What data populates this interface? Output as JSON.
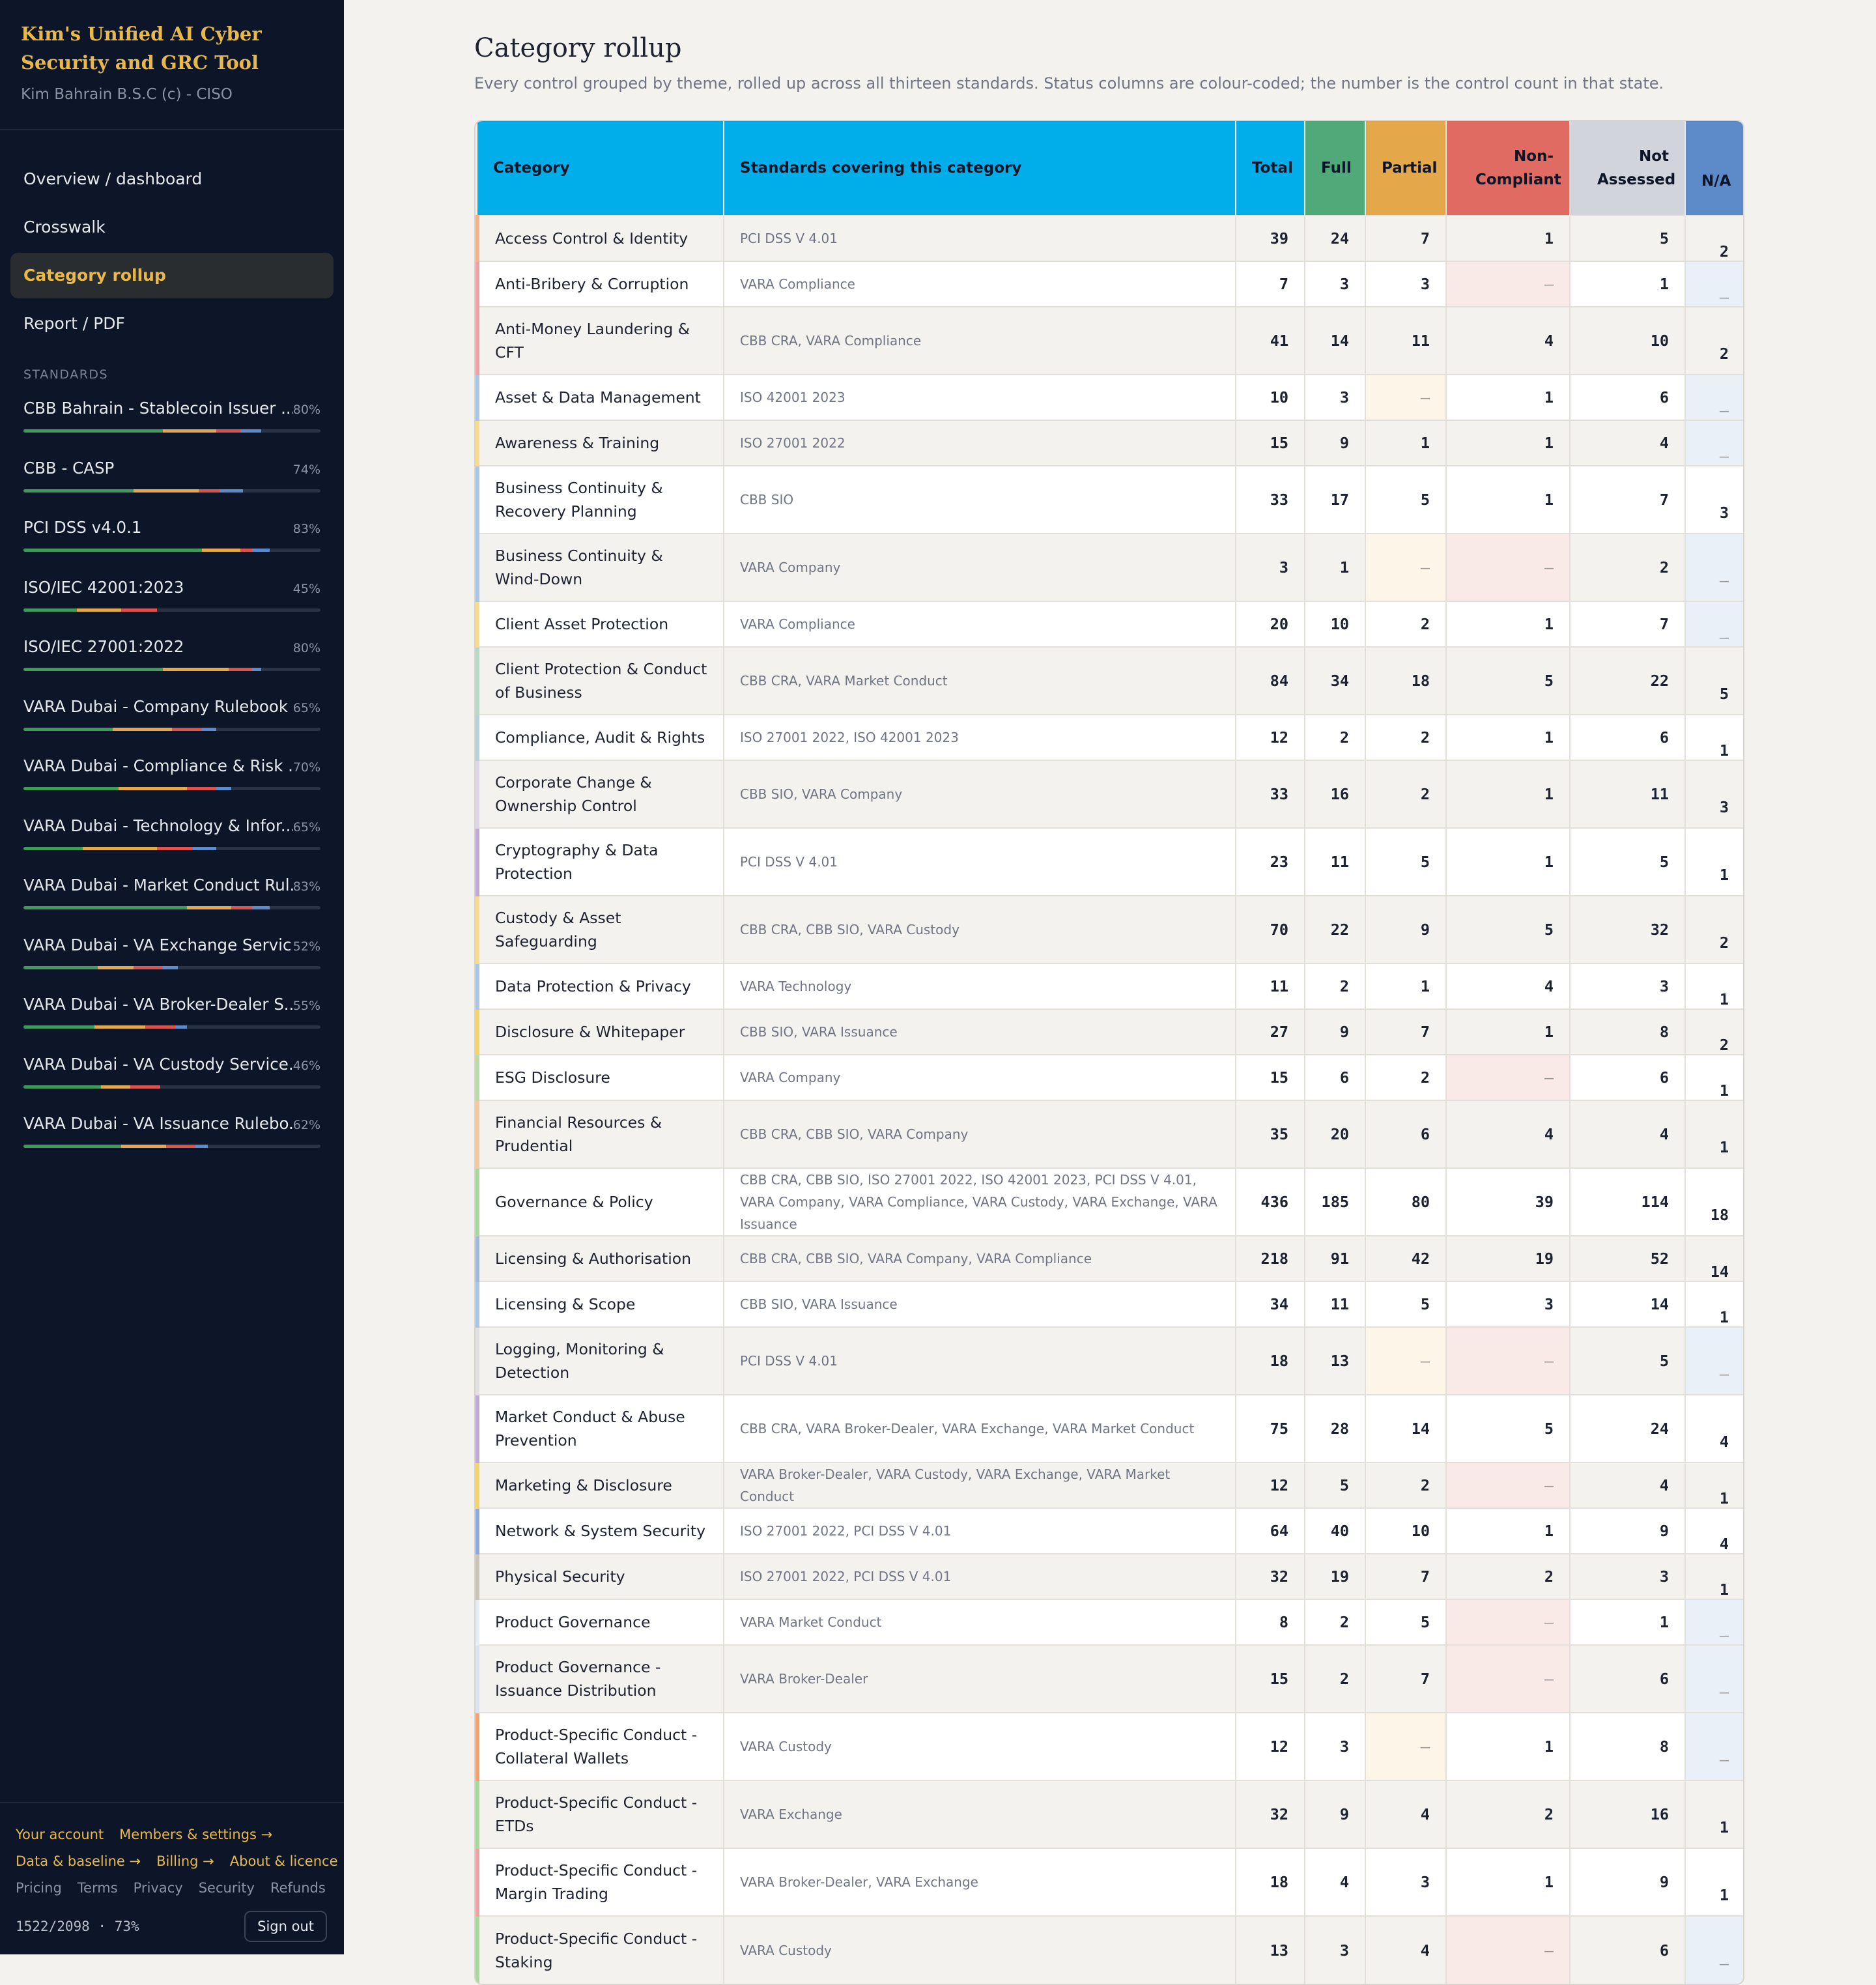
{
  "sidebar": {
    "title": "Kim's Unified AI Cyber Security and GRC Tool",
    "subtitle": "Kim Bahrain B.S.C (c) - CISO",
    "nav": [
      {
        "label": "Overview / dashboard",
        "active": false
      },
      {
        "label": "Crosswalk",
        "active": false
      },
      {
        "label": "Category rollup",
        "active": true
      },
      {
        "label": "Report / PDF",
        "active": false
      }
    ],
    "standards_heading": "STANDARDS",
    "standards": [
      {
        "name": "CBB Bahrain - Stablecoin Issuer ...",
        "pct": "80%",
        "segments": [
          0.47,
          0.18,
          0.08,
          0.07
        ]
      },
      {
        "name": "CBB - CASP",
        "pct": "74%",
        "segments": [
          0.37,
          0.22,
          0.07,
          0.08
        ]
      },
      {
        "name": "PCI DSS v4.0.1",
        "pct": "83%",
        "segments": [
          0.6,
          0.13,
          0.04,
          0.06
        ]
      },
      {
        "name": "ISO/IEC 42001:2023",
        "pct": "45%",
        "segments": [
          0.18,
          0.15,
          0.12,
          0.0
        ]
      },
      {
        "name": "ISO/IEC 27001:2022",
        "pct": "80%",
        "segments": [
          0.47,
          0.22,
          0.08,
          0.03
        ]
      },
      {
        "name": "VARA Dubai - Company Rulebook",
        "pct": "65%",
        "segments": [
          0.3,
          0.2,
          0.1,
          0.05
        ]
      },
      {
        "name": "VARA Dubai - Compliance & Risk ...",
        "pct": "70%",
        "segments": [
          0.32,
          0.23,
          0.1,
          0.05
        ]
      },
      {
        "name": "VARA Dubai - Technology & Infor...",
        "pct": "65%",
        "segments": [
          0.2,
          0.25,
          0.12,
          0.08
        ]
      },
      {
        "name": "VARA Dubai - Market Conduct Rul...",
        "pct": "83%",
        "segments": [
          0.55,
          0.15,
          0.07,
          0.06
        ]
      },
      {
        "name": "VARA Dubai - VA Exchange Servic...",
        "pct": "52%",
        "segments": [
          0.25,
          0.12,
          0.1,
          0.05
        ]
      },
      {
        "name": "VARA Dubai - VA Broker-Dealer S...",
        "pct": "55%",
        "segments": [
          0.24,
          0.17,
          0.1,
          0.04
        ]
      },
      {
        "name": "VARA Dubai - VA Custody Service...",
        "pct": "46%",
        "segments": [
          0.26,
          0.1,
          0.1,
          0.0
        ]
      },
      {
        "name": "VARA Dubai - VA Issuance Rulebo...",
        "pct": "62%",
        "segments": [
          0.33,
          0.15,
          0.1,
          0.04
        ]
      }
    ],
    "footer": {
      "row1": [
        "Your account",
        "Members & settings →"
      ],
      "row2": [
        "Data & baseline →",
        "Billing →",
        "About & licence"
      ],
      "row3": [
        "Pricing",
        "Terms",
        "Privacy",
        "Security",
        "Refunds"
      ],
      "count": "1522/2098  ·  73%",
      "signout": "Sign out"
    }
  },
  "colors": {
    "full": "#3f9a5c",
    "partial": "#e4a84b",
    "nc": "#d9534f",
    "nav": "#5d8ac8"
  },
  "main": {
    "title": "Category rollup",
    "description": "Every control grouped by theme, rolled up across all thirteen standards. Status columns are colour-coded; the number is the control count in that state.",
    "columns": [
      "Category",
      "Standards covering this category",
      "Total",
      "Full",
      "Partial",
      "Non-Compliant",
      "Not Assessed",
      "N/A"
    ],
    "rows": [
      {
        "cat": "Access Control & Identity",
        "std": "PCI DSS V 4.01",
        "total": "39",
        "full": "24",
        "partial": "7",
        "nc": "1",
        "na": "5",
        "nav": "2",
        "accent": "#f3b38a"
      },
      {
        "cat": "Anti-Bribery & Corruption",
        "std": "VARA Compliance",
        "total": "7",
        "full": "3",
        "partial": "3",
        "nc": "–",
        "na": "1",
        "nav": "–",
        "accent": "#f0a0a0"
      },
      {
        "cat": "Anti-Money Laundering & CFT",
        "std": "CBB CRA, VARA Compliance",
        "total": "41",
        "full": "14",
        "partial": "11",
        "nc": "4",
        "na": "10",
        "nav": "2",
        "accent": "#f0a0a0"
      },
      {
        "cat": "Asset & Data Management",
        "std": "ISO 42001 2023",
        "total": "10",
        "full": "3",
        "partial": "–",
        "nc": "1",
        "na": "6",
        "nav": "–",
        "accent": "#a9c6e8"
      },
      {
        "cat": "Awareness & Training",
        "std": "ISO 27001 2022",
        "total": "15",
        "full": "9",
        "partial": "1",
        "nc": "1",
        "na": "4",
        "nav": "–",
        "accent": "#f6dc8c"
      },
      {
        "cat": "Business Continuity & Recovery Planning",
        "std": "CBB SIO",
        "total": "33",
        "full": "17",
        "partial": "5",
        "nc": "1",
        "na": "7",
        "nav": "3",
        "accent": "#a9c6e8"
      },
      {
        "cat": "Business Continuity & Wind-Down",
        "std": "VARA Company",
        "total": "3",
        "full": "1",
        "partial": "–",
        "nc": "–",
        "na": "2",
        "nav": "–",
        "accent": "#a9c6e8"
      },
      {
        "cat": "Client Asset Protection",
        "std": "VARA Compliance",
        "total": "20",
        "full": "10",
        "partial": "2",
        "nc": "1",
        "na": "7",
        "nav": "–",
        "accent": "#f6dc8c"
      },
      {
        "cat": "Client Protection & Conduct of Business",
        "std": "CBB CRA, VARA Market Conduct",
        "total": "84",
        "full": "34",
        "partial": "18",
        "nc": "5",
        "na": "22",
        "nav": "5",
        "accent": "#b8d8c8"
      },
      {
        "cat": "Compliance, Audit & Rights",
        "std": "ISO 27001 2022, ISO 42001 2023",
        "total": "12",
        "full": "2",
        "partial": "2",
        "nc": "1",
        "na": "6",
        "nav": "1",
        "accent": "#b8d0dc"
      },
      {
        "cat": "Corporate Change & Ownership Control",
        "std": "CBB SIO, VARA Company",
        "total": "33",
        "full": "16",
        "partial": "2",
        "nc": "1",
        "na": "11",
        "nav": "3",
        "accent": "#dcd6e6"
      },
      {
        "cat": "Cryptography & Data Protection",
        "std": "PCI DSS V 4.01",
        "total": "23",
        "full": "11",
        "partial": "5",
        "nc": "1",
        "na": "5",
        "nav": "1",
        "accent": "#c0a8d8"
      },
      {
        "cat": "Custody & Asset Safeguarding",
        "std": "CBB CRA, CBB SIO, VARA Custody",
        "total": "70",
        "full": "22",
        "partial": "9",
        "nc": "5",
        "na": "32",
        "nav": "2",
        "accent": "#f6dc8c"
      },
      {
        "cat": "Data Protection & Privacy",
        "std": "VARA Technology",
        "total": "11",
        "full": "2",
        "partial": "1",
        "nc": "4",
        "na": "3",
        "nav": "1",
        "accent": "#a9c6e8"
      },
      {
        "cat": "Disclosure & Whitepaper",
        "std": "CBB SIO, VARA Issuance",
        "total": "27",
        "full": "9",
        "partial": "7",
        "nc": "1",
        "na": "8",
        "nav": "2",
        "accent": "#f3d36a"
      },
      {
        "cat": "ESG Disclosure",
        "std": "VARA Company",
        "total": "15",
        "full": "6",
        "partial": "2",
        "nc": "–",
        "na": "6",
        "nav": "1",
        "accent": "#b8dca8"
      },
      {
        "cat": "Financial Resources & Prudential",
        "std": "CBB CRA, CBB SIO, VARA Company",
        "total": "35",
        "full": "20",
        "partial": "6",
        "nc": "4",
        "na": "4",
        "nav": "1",
        "accent": "#f3c8a0"
      },
      {
        "cat": "Governance & Policy",
        "std": "CBB CRA, CBB SIO, ISO 27001 2022, ISO 42001 2023, PCI DSS V 4.01, VARA Company, VARA Compliance, VARA Custody, VARA Exchange, VARA Issuance",
        "total": "436",
        "full": "185",
        "partial": "80",
        "nc": "39",
        "na": "114",
        "nav": "18",
        "accent": "#a8d89c"
      },
      {
        "cat": "Licensing & Authorisation",
        "std": "CBB CRA, CBB SIO, VARA Company, VARA Compliance",
        "total": "218",
        "full": "91",
        "partial": "42",
        "nc": "19",
        "na": "52",
        "nav": "14",
        "accent": "#a0b8dc"
      },
      {
        "cat": "Licensing & Scope",
        "std": "CBB SIO, VARA Issuance",
        "total": "34",
        "full": "11",
        "partial": "5",
        "nc": "3",
        "na": "14",
        "nav": "1",
        "accent": "#a9c6e8"
      },
      {
        "cat": "Logging, Monitoring & Detection",
        "std": "PCI DSS V 4.01",
        "total": "18",
        "full": "13",
        "partial": "–",
        "nc": "–",
        "na": "5",
        "nav": "–",
        "accent": "#e0e0e0"
      },
      {
        "cat": "Market Conduct & Abuse Prevention",
        "std": "CBB CRA, VARA Broker-Dealer, VARA Exchange, VARA Market Conduct",
        "total": "75",
        "full": "28",
        "partial": "14",
        "nc": "5",
        "na": "24",
        "nav": "4",
        "accent": "#c0a8d8"
      },
      {
        "cat": "Marketing & Disclosure",
        "std": "VARA Broker-Dealer, VARA Custody, VARA Exchange, VARA Market Conduct",
        "total": "12",
        "full": "5",
        "partial": "2",
        "nc": "–",
        "na": "4",
        "nav": "1",
        "accent": "#f3d36a"
      },
      {
        "cat": "Network & System Security",
        "std": "ISO 27001 2022, PCI DSS V 4.01",
        "total": "64",
        "full": "40",
        "partial": "10",
        "nc": "1",
        "na": "9",
        "nav": "4",
        "accent": "#8ca8dc"
      },
      {
        "cat": "Physical Security",
        "std": "ISO 27001 2022, PCI DSS V 4.01",
        "total": "32",
        "full": "19",
        "partial": "7",
        "nc": "2",
        "na": "3",
        "nav": "1",
        "accent": "#c8c4b8"
      },
      {
        "cat": "Product Governance",
        "std": "VARA Market Conduct",
        "total": "8",
        "full": "2",
        "partial": "5",
        "nc": "–",
        "na": "1",
        "nav": "–",
        "accent": "#e8ecf4"
      },
      {
        "cat": "Product Governance - Issuance Distribution",
        "std": "VARA Broker-Dealer",
        "total": "15",
        "full": "2",
        "partial": "7",
        "nc": "–",
        "na": "6",
        "nav": "–",
        "accent": "#dce2f0"
      },
      {
        "cat": "Product-Specific Conduct - Collateral Wallets",
        "std": "VARA Custody",
        "total": "12",
        "full": "3",
        "partial": "–",
        "nc": "1",
        "na": "8",
        "nav": "–",
        "accent": "#f3a070"
      },
      {
        "cat": "Product-Specific Conduct - ETDs",
        "std": "VARA Exchange",
        "total": "32",
        "full": "9",
        "partial": "4",
        "nc": "2",
        "na": "16",
        "nav": "1",
        "accent": "#a8d89c"
      },
      {
        "cat": "Product-Specific Conduct - Margin Trading",
        "std": "VARA Broker-Dealer, VARA Exchange",
        "total": "18",
        "full": "4",
        "partial": "3",
        "nc": "1",
        "na": "9",
        "nav": "1",
        "accent": "#f0a0a0"
      },
      {
        "cat": "Product-Specific Conduct - Staking",
        "std": "VARA Custody",
        "total": "13",
        "full": "3",
        "partial": "4",
        "nc": "–",
        "na": "6",
        "nav": "–",
        "accent": "#a8d89c"
      }
    ]
  }
}
